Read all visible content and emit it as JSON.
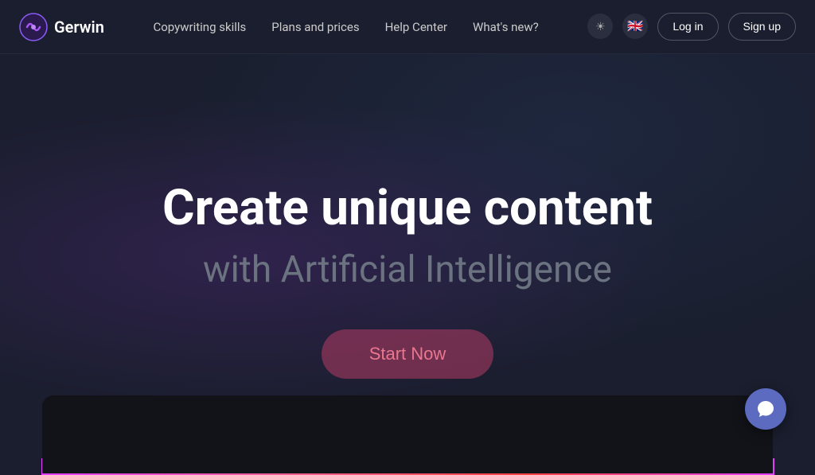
{
  "navbar": {
    "brand_name": "Gerwin",
    "nav_links": [
      {
        "label": "Copywriting skills",
        "id": "copywriting-skills"
      },
      {
        "label": "Plans and prices",
        "id": "plans-prices"
      },
      {
        "label": "Help Center",
        "id": "help-center"
      },
      {
        "label": "What's new?",
        "id": "whats-new"
      }
    ],
    "theme_toggle_icon": "☀",
    "lang_flag": "🇬🇧",
    "login_label": "Log in",
    "signup_label": "Sign up"
  },
  "hero": {
    "title": "Create unique content",
    "subtitle": "with Artificial Intelligence",
    "cta_label": "Start Now"
  },
  "chat": {
    "icon": "💬"
  }
}
